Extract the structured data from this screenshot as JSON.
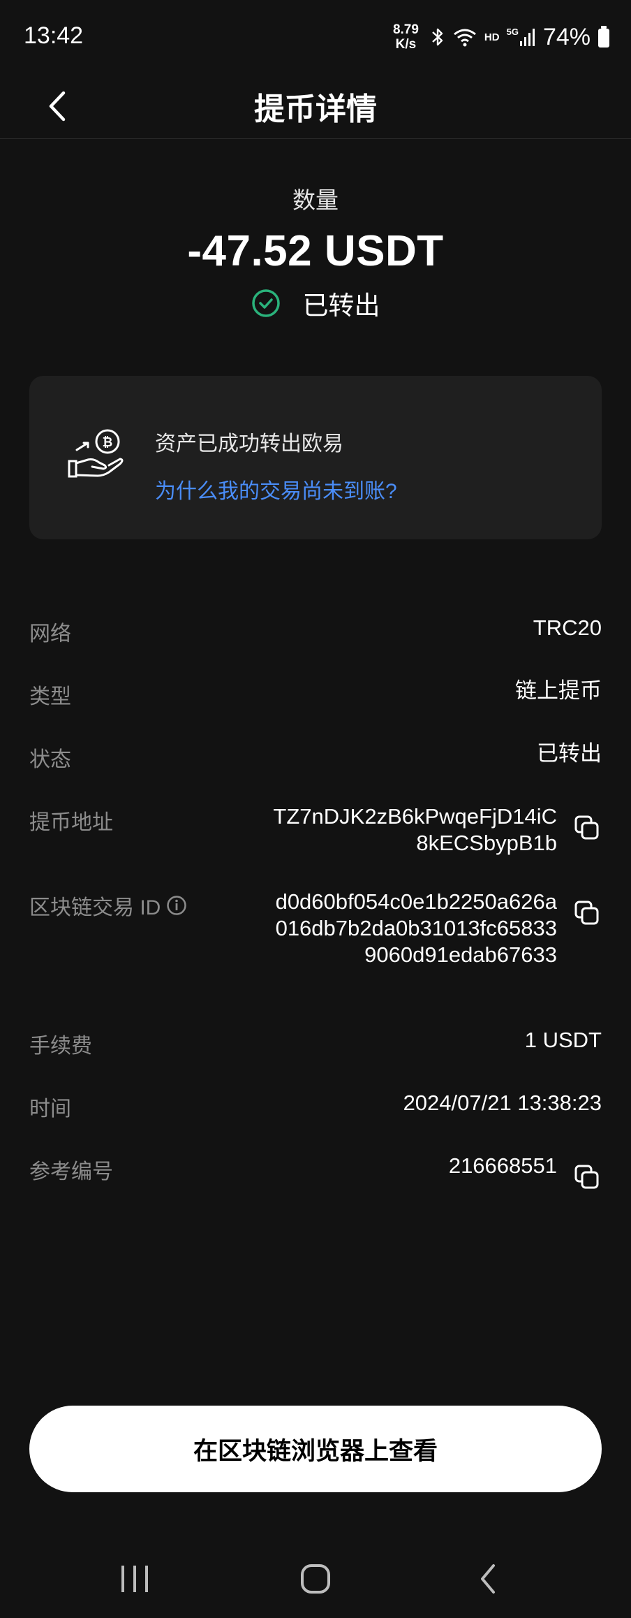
{
  "status_bar": {
    "time": "13:42",
    "net_speed_value": "8.79",
    "net_speed_unit": "K/s",
    "hd": "HD",
    "signal_type": "5G",
    "battery": "74%"
  },
  "header": {
    "title": "提币详情"
  },
  "amount": {
    "label": "数量",
    "value": "-47.52 USDT",
    "status": "已转出",
    "status_color": "#2ab27b"
  },
  "info_card": {
    "title": "资产已成功转出欧易",
    "link": "为什么我的交易尚未到账?",
    "link_color": "#4a8df8"
  },
  "details": {
    "network": {
      "label": "网络",
      "value": "TRC20"
    },
    "type": {
      "label": "类型",
      "value": "链上提币"
    },
    "state": {
      "label": "状态",
      "value": "已转出"
    },
    "address": {
      "label": "提币地址",
      "value": "TZ7nDJK2zB6kPwqeFjD14iC8kECSbypB1b"
    },
    "txid": {
      "label": "区块链交易 ID",
      "value": "d0d60bf054c0e1b2250a626a016db7b2da0b31013fc658339060d91edab67633"
    },
    "fee": {
      "label": "手续费",
      "value": "1 USDT"
    },
    "time": {
      "label": "时间",
      "value": "2024/07/21 13:38:23"
    },
    "reference": {
      "label": "参考编号",
      "value": "216668551"
    }
  },
  "actions": {
    "view_explorer": "在区块链浏览器上查看"
  },
  "icons": {
    "back": "chevron-left-icon",
    "check": "check-circle-icon",
    "coin_hand": "coin-hand-icon",
    "info": "info-icon",
    "copy": "copy-icon",
    "nav_recents": "recents-icon",
    "nav_home": "home-icon",
    "nav_back": "back-icon"
  }
}
